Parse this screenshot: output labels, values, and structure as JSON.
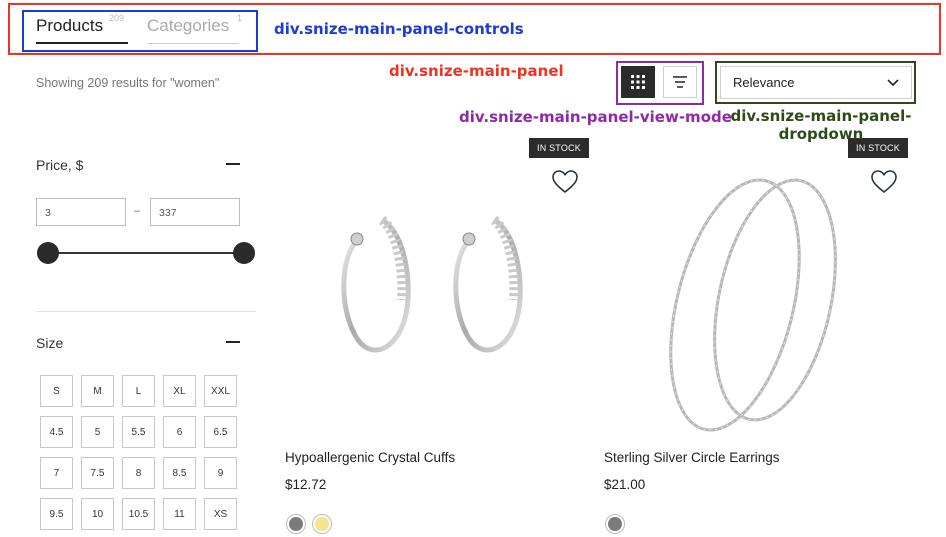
{
  "tabs": [
    {
      "label": "Products",
      "count": "209"
    },
    {
      "label": "Categories",
      "count": "1"
    }
  ],
  "results_summary": "Showing 209 results for \"women\"",
  "view_mode": {
    "active": "grid",
    "options": [
      "grid-icon",
      "list-icon"
    ]
  },
  "sort": {
    "selected": "Relevance"
  },
  "filters": {
    "price": {
      "title": "Price, $",
      "min": "3",
      "max": "337",
      "range_min": 3,
      "range_max": 337,
      "selected_min": 3,
      "selected_max": 337
    },
    "size": {
      "title": "Size",
      "options": [
        "S",
        "M",
        "L",
        "XL",
        "XXL",
        "4.5",
        "5",
        "5.5",
        "6",
        "6.5",
        "7",
        "7.5",
        "8",
        "8.5",
        "9",
        "9.5",
        "10",
        "10.5",
        "11",
        "XS"
      ]
    }
  },
  "products": [
    {
      "title": "Hypoallergenic Crystal Cuffs",
      "price": "$12.72",
      "badge": "IN STOCK",
      "swatches": [
        "#7a7a7a",
        "#f4e48a"
      ]
    },
    {
      "title": "Sterling Silver Circle Earrings",
      "price": "$21.00",
      "badge": "IN STOCK",
      "swatches": [
        "#7a7a7a"
      ]
    }
  ],
  "annotations": [
    {
      "label": "div.snize-main-panel-controls",
      "color": "#1e3ad9"
    },
    {
      "label": "div.snize-main-panel",
      "color": "#ee3322"
    },
    {
      "label": "div.snize-main-panel-view-mode",
      "color": "#8e2aa3"
    },
    {
      "label": "div.snize-main-panel-dropdown",
      "color": "#2f4a19"
    }
  ],
  "colors": {
    "panel_border": "#ee3322",
    "controls_border": "#1e3ad9",
    "view_mode_border": "#8e2aa3",
    "dropdown_border": "#2f4a19",
    "dark": "#2b2b2b"
  }
}
